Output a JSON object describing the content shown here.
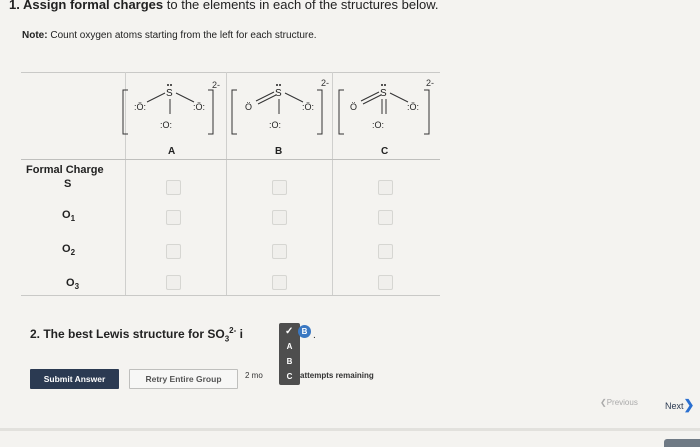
{
  "q1": {
    "number": "1.",
    "bold_text": "Assign formal charges",
    "rest_text": "to the elements in each of the structures below.",
    "note_label": "Note:",
    "note_text": "Count oxygen atoms starting from the left for each structure."
  },
  "structures": [
    {
      "label": "A",
      "charge": "2-",
      "center": "S",
      "o1": ":Ö:",
      "o2": ":O:",
      "o3": ":Ö:"
    },
    {
      "label": "B",
      "charge": "2-",
      "center": "S",
      "o1": "Ö",
      "o2": ":O:",
      "o3": ":Ö:"
    },
    {
      "label": "C",
      "charge": "2-",
      "center": "S",
      "o1": "Ö",
      "o2": ":O:",
      "o3": ":Ö:"
    }
  ],
  "table": {
    "formal_charge_title": "Formal Charge",
    "rows": [
      {
        "label": "S",
        "sub": ""
      },
      {
        "label": "O",
        "sub": "1"
      },
      {
        "label": "O",
        "sub": "2"
      },
      {
        "label": "O",
        "sub": "3"
      }
    ]
  },
  "q2": {
    "text": "2. The best Lewis structure for SO",
    "sub": "3",
    "sup": "2-",
    "tail": "i",
    "selected_value": "B",
    "options": [
      "A",
      "B",
      "C"
    ]
  },
  "buttons": {
    "submit": "Submit Answer",
    "retry": "Retry Entire Group",
    "attempts_left": "2 mo",
    "attempts_right": "attempts remaining"
  },
  "nav": {
    "previous": "Previous",
    "next": "Next"
  },
  "colors": {
    "submit_bg": "#2b3a52",
    "dropdown_bg": "#4e4e4e",
    "accent_blue": "#3a78c2"
  }
}
